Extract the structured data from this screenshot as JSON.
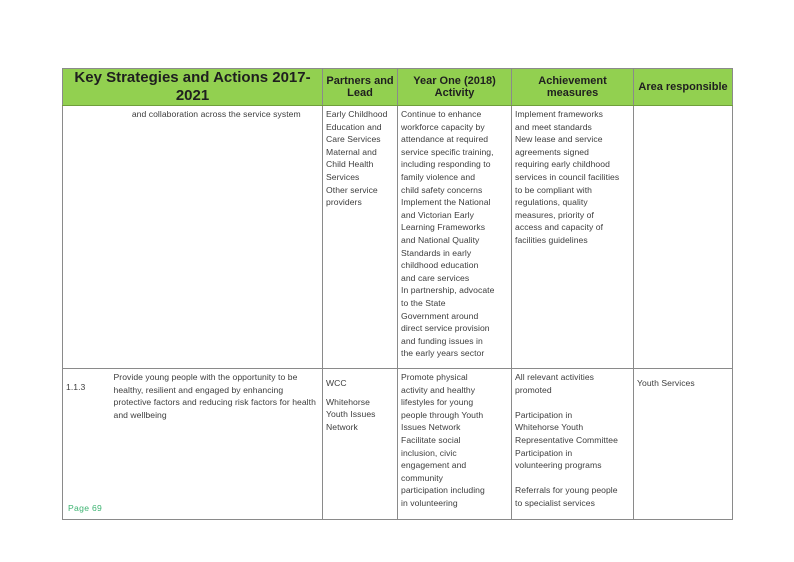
{
  "table": {
    "headers": {
      "strategies": "Key Strategies and Actions 2017-2021",
      "partners": "Partners and Lead",
      "activity": "Year One (2018) Activity",
      "achievement": "Achievement measures",
      "area": "Area responsible"
    },
    "header_color": "#92D050",
    "rows": [
      {
        "number": "",
        "strategy": "and collaboration across the service system",
        "partners": [
          "Early Childhood",
          "Education and",
          "Care Services",
          "Maternal and",
          "Child Health",
          "Services",
          "Other service",
          "providers"
        ],
        "activity": [
          "Continue to enhance",
          "workforce capacity by",
          "attendance at required",
          "service specific training,",
          "including responding to",
          "family violence and",
          "child safety concerns",
          "Implement the National",
          "and Victorian Early",
          "Learning Frameworks",
          "and National Quality",
          "Standards in early",
          "childhood education",
          "and care services",
          "In partnership, advocate",
          "to the State",
          "Government around",
          "direct service provision",
          "and funding issues in",
          "the early years sector"
        ],
        "achievement": [
          "Implement frameworks",
          "and meet standards",
          "New lease and service",
          "agreements signed",
          "requiring early childhood",
          "services in council facilities",
          "to be compliant with",
          "regulations, quality",
          "measures, priority of",
          "access and capacity of",
          "facilities guidelines"
        ],
        "area": ""
      },
      {
        "number": "1.1.3",
        "strategy": "Provide young people with the opportunity to be healthy, resilient and engaged by enhancing protective factors and reducing risk factors for health and wellbeing",
        "partners": [
          "WCC",
          "",
          "Whitehorse",
          "Youth Issues",
          "Network"
        ],
        "activity": [
          "Promote physical",
          "activity and healthy",
          "lifestyles for young",
          "people through Youth",
          "Issues Network",
          "Facilitate social",
          "inclusion, civic",
          "engagement and",
          "community",
          "participation including",
          "in volunteering"
        ],
        "achievement": [
          "All relevant activities",
          "promoted",
          "",
          "Participation in",
          "Whitehorse Youth",
          "Representative Committee",
          "Participation in",
          "volunteering programs",
          "",
          "Referrals for young people",
          "to specialist services"
        ],
        "area": "Youth Services"
      }
    ]
  },
  "footer": {
    "page_label": "Page 69",
    "page_color": "#3cb371"
  }
}
